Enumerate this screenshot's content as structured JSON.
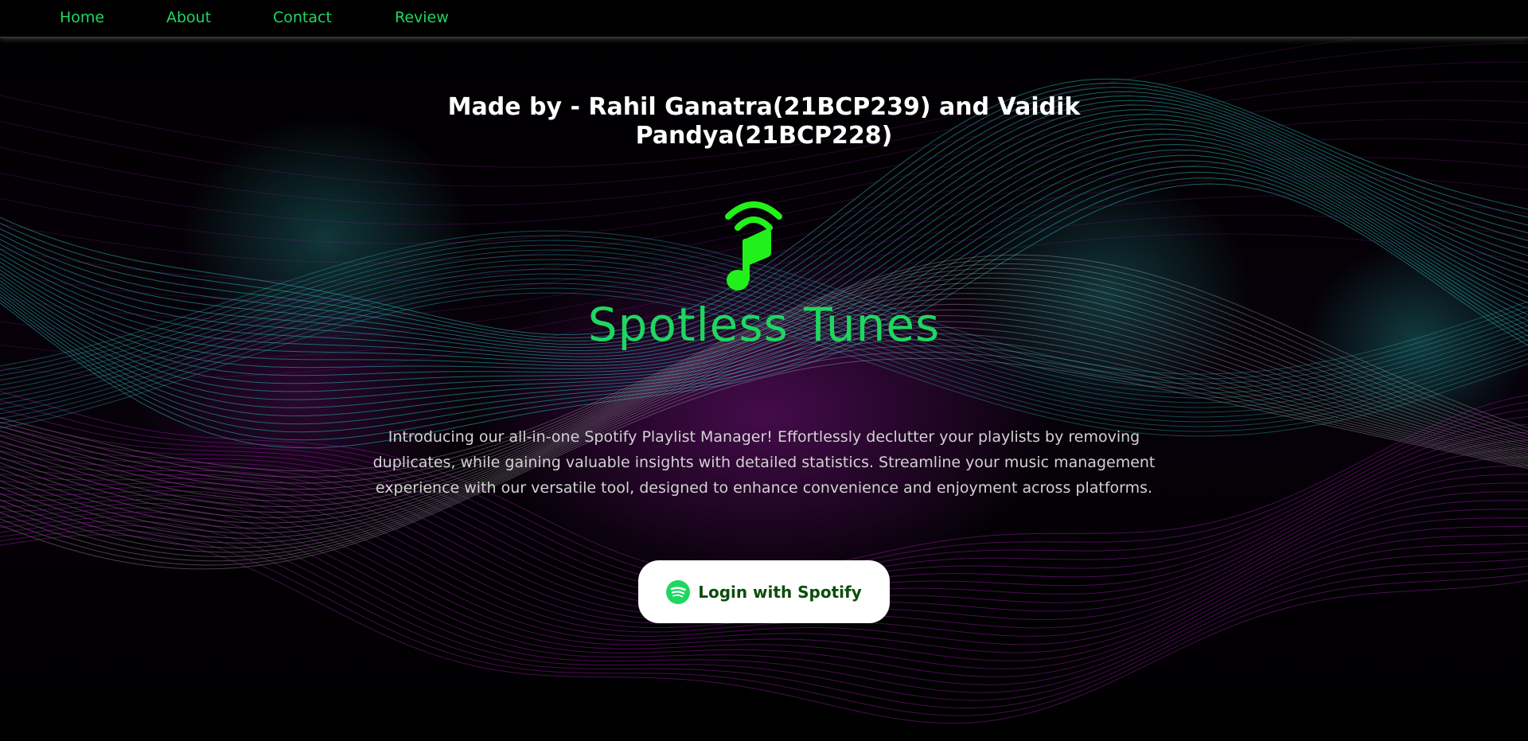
{
  "nav": {
    "items": [
      {
        "label": "Home"
      },
      {
        "label": "About"
      },
      {
        "label": "Contact"
      },
      {
        "label": "Review"
      }
    ]
  },
  "header": {
    "made_by": "Made by - Rahil Ganatra(21BCP239) and Vaidik Pandya(21BCP228)"
  },
  "brand": {
    "icon": "music-note-wifi-icon",
    "title": "Spotless Tunes"
  },
  "description": "Introducing our all-in-one Spotify Playlist Manager! Effortlessly declutter your playlists by removing duplicates, while gaining valuable insights with detailed statistics. Streamline your music management experience with our versatile tool, designed to enhance convenience and enjoyment across platforms.",
  "login": {
    "icon": "spotify-icon",
    "label": "Login with Spotify"
  },
  "colors": {
    "accent": "#1ed760",
    "logo_green": "#22f01a",
    "button_text": "#0b4d0b",
    "wave_teal": "#2ab7b0",
    "wave_purple": "#a020b0"
  }
}
